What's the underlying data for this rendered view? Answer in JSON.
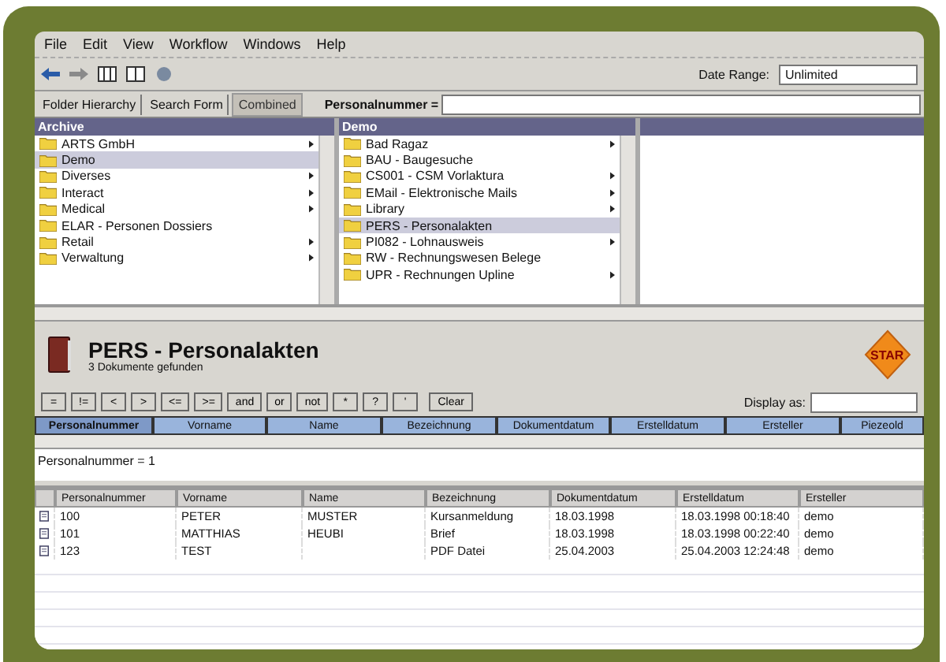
{
  "menu": [
    "File",
    "Edit",
    "View",
    "Workflow",
    "Windows",
    "Help"
  ],
  "toolbar": {
    "date_range_label": "Date Range:",
    "date_range_value": "Unlimited"
  },
  "tabs": [
    {
      "label": "Folder Hierarchy",
      "selected": false
    },
    {
      "label": "Search Form",
      "selected": false
    },
    {
      "label": "Combined",
      "selected": true
    }
  ],
  "search": {
    "label": "Personalnummer ="
  },
  "archive": {
    "title": "Archive",
    "items": [
      {
        "label": "ARTS GmbH",
        "submenu": true,
        "selected": false
      },
      {
        "label": "Demo",
        "submenu": false,
        "selected": true
      },
      {
        "label": "Diverses",
        "submenu": true,
        "selected": false
      },
      {
        "label": "Interact",
        "submenu": true,
        "selected": false
      },
      {
        "label": "Medical",
        "submenu": true,
        "selected": false
      },
      {
        "label": "ELAR - Personen Dossiers",
        "submenu": false,
        "selected": false
      },
      {
        "label": "Retail",
        "submenu": true,
        "selected": false
      },
      {
        "label": "Verwaltung",
        "submenu": true,
        "selected": false
      }
    ]
  },
  "folder": {
    "title": "Demo",
    "items": [
      {
        "label": "Bad Ragaz",
        "submenu": true,
        "selected": false
      },
      {
        "label": "BAU - Baugesuche",
        "submenu": false,
        "selected": false
      },
      {
        "label": "CS001 - CSM Vorlaktura",
        "submenu": true,
        "selected": false
      },
      {
        "label": "EMail - Elektronische Mails",
        "submenu": true,
        "selected": false
      },
      {
        "label": "Library",
        "submenu": true,
        "selected": false
      },
      {
        "label": "PERS - Personalakten",
        "submenu": false,
        "selected": true
      },
      {
        "label": "PI082 - Lohnausweis",
        "submenu": true,
        "selected": false
      },
      {
        "label": "RW - Rechnungswesen Belege",
        "submenu": false,
        "selected": false
      },
      {
        "label": "UPR - Rechnungen Upline",
        "submenu": true,
        "selected": false
      }
    ]
  },
  "document_type": {
    "title": "PERS - Personalakten",
    "subtitle": "3 Dokumente gefunden",
    "start_label": "STAR"
  },
  "operators": [
    "=",
    "!=",
    "<",
    ">",
    "<=",
    ">=",
    "and",
    "or",
    "not",
    "*",
    "?",
    "'"
  ],
  "clear_button": "Clear",
  "display_as_label": "Display as:",
  "query_columns": [
    {
      "label": "Personalnummer",
      "selected": true
    },
    {
      "label": "Vorname",
      "selected": false
    },
    {
      "label": "Name",
      "selected": false
    },
    {
      "label": "Bezeichnung",
      "selected": false
    },
    {
      "label": "Dokumentdatum",
      "selected": false
    },
    {
      "label": "Erstelldatum",
      "selected": false
    },
    {
      "label": "Ersteller",
      "selected": false
    },
    {
      "label": "Piezeold",
      "selected": false
    }
  ],
  "query_text": "Personalnummer = 1",
  "results": {
    "columns": [
      "Personalnummer",
      "Vorname",
      "Name",
      "Bezeichnung",
      "Dokumentdatum",
      "Erstelldatum",
      "Ersteller"
    ],
    "rows": [
      [
        "100",
        "PETER",
        "MUSTER",
        "Kursanmeldung",
        "18.03.1998",
        "18.03.1998 00:18:40",
        "demo"
      ],
      [
        "101",
        "MATTHIAS",
        "HEUBI",
        "Brief",
        "18.03.1998",
        "18.03.1998 00:22:40",
        "demo"
      ],
      [
        "123",
        "TEST",
        null,
        "PDF Datei",
        "25.04.2003",
        "25.04.2003 12:24:48",
        "demo"
      ]
    ]
  }
}
